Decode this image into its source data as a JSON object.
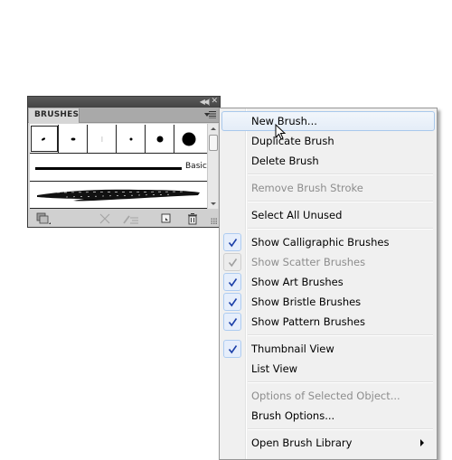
{
  "panel": {
    "tab_label": "BRUSHES",
    "titlebar": {
      "collapse_icon": "double-chevron-left-icon",
      "close_icon": "close-icon"
    },
    "thumbnails": [
      {
        "name": "calligraphic-1",
        "selected": true
      },
      {
        "name": "calligraphic-2",
        "selected": false
      },
      {
        "name": "calligraphic-3",
        "selected": false
      },
      {
        "name": "round-small",
        "selected": false
      },
      {
        "name": "round-medium",
        "selected": false
      },
      {
        "name": "round-large",
        "selected": false
      }
    ],
    "basic_brush_label": "Basic",
    "footer_buttons": [
      "brush-libraries-menu",
      "remove-brush-stroke",
      "options-of-selected-object",
      "new-brush",
      "delete-brush"
    ]
  },
  "menu": {
    "items": [
      {
        "label": "New Brush...",
        "enabled": true,
        "checked": false,
        "hover": true
      },
      {
        "label": "Duplicate Brush",
        "enabled": true,
        "checked": false
      },
      {
        "label": "Delete Brush",
        "enabled": true,
        "checked": false
      },
      {
        "separator": true
      },
      {
        "label": "Remove Brush Stroke",
        "enabled": false,
        "checked": false
      },
      {
        "separator": true
      },
      {
        "label": "Select All Unused",
        "enabled": true,
        "checked": false
      },
      {
        "separator": true
      },
      {
        "label": "Show Calligraphic Brushes",
        "enabled": true,
        "checked": true
      },
      {
        "label": "Show Scatter Brushes",
        "enabled": false,
        "checked": true
      },
      {
        "label": "Show Art Brushes",
        "enabled": true,
        "checked": true
      },
      {
        "label": "Show Bristle Brushes",
        "enabled": true,
        "checked": true
      },
      {
        "label": "Show Pattern Brushes",
        "enabled": true,
        "checked": true
      },
      {
        "separator": true
      },
      {
        "label": "Thumbnail View",
        "enabled": true,
        "checked": true
      },
      {
        "label": "List View",
        "enabled": true,
        "checked": false
      },
      {
        "separator": true
      },
      {
        "label": "Options of Selected Object...",
        "enabled": false,
        "checked": false
      },
      {
        "label": "Brush Options...",
        "enabled": true,
        "checked": false
      },
      {
        "separator": true
      },
      {
        "label": "Open Brush Library",
        "enabled": true,
        "checked": false,
        "submenu": true
      }
    ]
  },
  "colors": {
    "check": "#1c3fa8",
    "check_disabled": "#a0a0a0",
    "disabled_text": "#8d8d8d"
  }
}
